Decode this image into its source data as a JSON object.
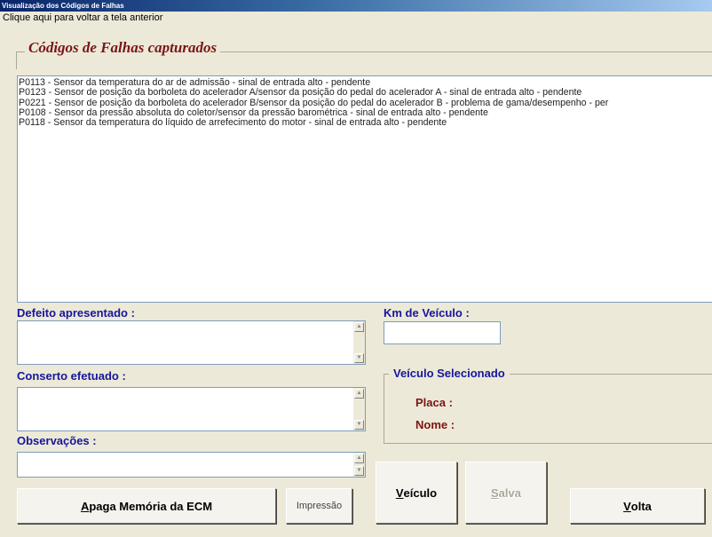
{
  "window": {
    "title": "Visualização dos Códigos de Falhas"
  },
  "back_link": "Clique aqui para voltar a tela anterior",
  "faults_group": {
    "title": "Códigos de Falhas capturados",
    "items": [
      "P0113 - Sensor da temperatura do ar de admissão - sinal de entrada alto - pendente",
      "P0123 - Sensor de posição da borboleta do acelerador A/sensor da posição do pedal do acelerador A - sinal de entrada alto - pendente",
      "P0221 - Sensor de posição da borboleta do acelerador B/sensor da posição do pedal do acelerador B - problema de gama/desempenho - per",
      "P0108 - Sensor da pressão absoluta do coletor/sensor da pressão barométrica - sinal de entrada alto - pendente",
      "P0118 - Sensor da temperatura do líquido de arrefecimento do motor - sinal de entrada alto - pendente"
    ]
  },
  "form": {
    "defeito_label": "Defeito apresentado :",
    "defeito_value": "",
    "conserto_label": "Conserto efetuado :",
    "conserto_value": "",
    "observacoes_label": "Observações :",
    "observacoes_value": "",
    "km_label": "Km de Veículo :",
    "km_value": ""
  },
  "vehicle": {
    "group_title": "Veículo Selecionado",
    "placa_label": "Placa :",
    "placa_value": "",
    "nome_label": "Nome :",
    "nome_value": ""
  },
  "buttons": {
    "apaga": {
      "mnemonic": "A",
      "rest": "paga Memória da ECM"
    },
    "impressao": "Impressão",
    "veiculo": {
      "mnemonic": "V",
      "rest": "eículo"
    },
    "salva": {
      "mnemonic": "S",
      "rest": "alva"
    },
    "volta": {
      "mnemonic": "V",
      "rest": "olta"
    }
  },
  "colors": {
    "label_blue": "#16169b",
    "label_dark_red": "#7a1515",
    "window_bg": "#ece9d8",
    "titlebar": "#0a246a"
  }
}
